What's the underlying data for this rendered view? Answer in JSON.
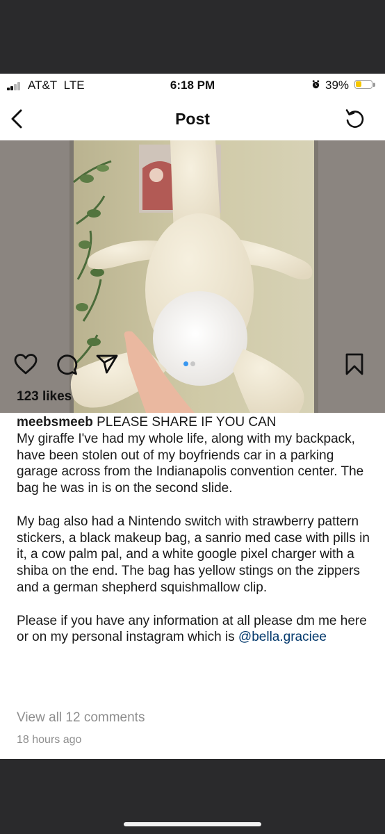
{
  "status_bar": {
    "carrier": "AT&T",
    "network": "LTE",
    "time": "6:18 PM",
    "battery_percent": "39%",
    "battery_level": 0.39,
    "battery_color": "#f6c700",
    "icons": [
      "signal-icon",
      "alarm-icon",
      "battery-icon"
    ]
  },
  "header": {
    "title": "Post",
    "icons": [
      "chevron-left-icon",
      "refresh-icon"
    ]
  },
  "post": {
    "image_description_icon": "photo",
    "carousel": {
      "total": 2,
      "current": 1,
      "active_color": "#3897f0",
      "inactive_color": "#c7c7c7"
    },
    "action_icons": [
      "heart-icon",
      "comment-icon",
      "share-icon",
      "bookmark-icon"
    ],
    "likes": "123 likes",
    "username": "meebsmeeb",
    "caption_first": "PLEASE SHARE IF YOU CAN",
    "caption_p1": "My giraffe I've had my whole life, along with my backpack, have been stolen out of my boyfriends car in a parking garage across from the Indianapolis convention center. The bag he was in is on the second slide.",
    "caption_p2": "My bag also had a Nintendo switch with strawberry pattern stickers, a black makeup bag, a sanrio med case with pills in it, a cow palm pal, and a white google pixel charger with a shiba on the end. The bag has yellow stings on the zippers and a german shepherd squishmallow clip.",
    "caption_p3": "Please if you have any information at all please dm me here or on my personal instagram which is",
    "mention": "@bella.graciee",
    "view_comments": "View all 12 comments",
    "time_ago": "18 hours ago"
  }
}
